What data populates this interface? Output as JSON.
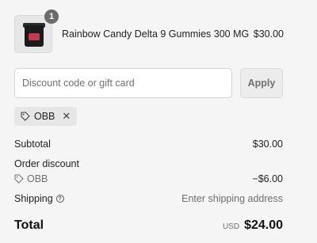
{
  "product": {
    "quantity": "1",
    "name": "Rainbow Candy Delta 9 Gummies 300 MG",
    "price": "$30.00"
  },
  "discount": {
    "placeholder": "Discount code or gift card",
    "apply_label": "Apply",
    "applied_code": "OBB"
  },
  "summary": {
    "subtotal_label": "Subtotal",
    "subtotal_value": "$30.00",
    "order_discount_label": "Order discount",
    "discount_code": "OBB",
    "discount_value": "−$6.00",
    "shipping_label": "Shipping",
    "shipping_value": "Enter shipping address",
    "total_label": "Total",
    "currency": "USD",
    "total_value": "$24.00"
  },
  "icons": {
    "tag": "tag-icon",
    "close": "close-icon",
    "info": "info-icon"
  }
}
